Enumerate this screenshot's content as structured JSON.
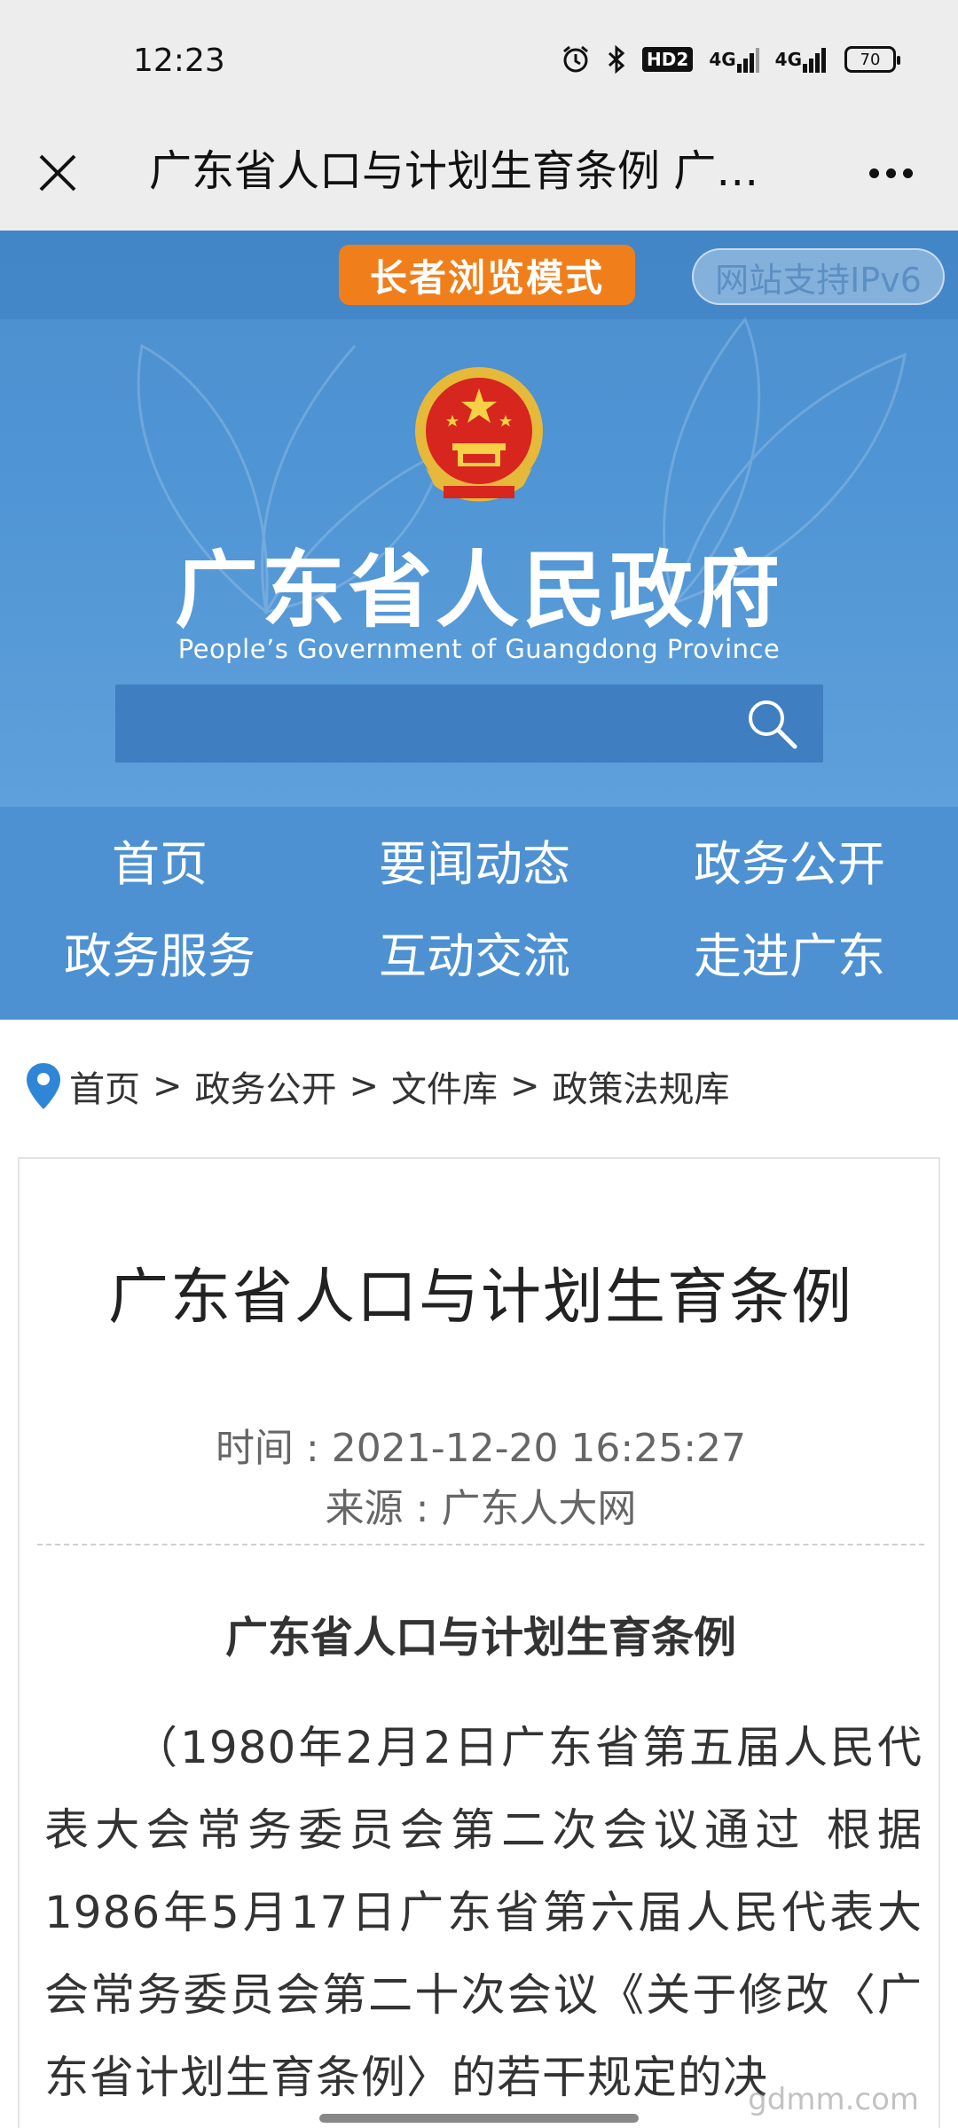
{
  "status_bar": {
    "time": "12:23",
    "icons": [
      "alarm-icon",
      "bluetooth-icon",
      "hd-icon",
      "signal-icon",
      "signal-icon",
      "battery-icon"
    ],
    "hd": "HD2",
    "sig1": "4G",
    "sig2": "4G",
    "battery": "70"
  },
  "title_bar": {
    "title": "广东省人口与计划生育条例  广…"
  },
  "header": {
    "elder_mode": "长者浏览模式",
    "ipv6": "网站支持IPv6",
    "gov_name": "广东省人民政府",
    "gov_name_en": "People’s Government of Guangdong Province",
    "search_placeholder": ""
  },
  "nav": {
    "items": [
      {
        "label": "首页"
      },
      {
        "label": "要闻动态"
      },
      {
        "label": "政务公开"
      },
      {
        "label": "政务服务"
      },
      {
        "label": "互动交流"
      },
      {
        "label": "走进广东"
      }
    ]
  },
  "breadcrumb": {
    "items": [
      "首页",
      "政务公开",
      "文件库",
      "政策法规库"
    ],
    "separator": ">"
  },
  "article": {
    "title": "广东省人口与计划生育条例",
    "time": "时间 : 2021-12-20 16:25:27",
    "source": "来源 : 广东人大网",
    "sub_title": "广东省人口与计划生育条例",
    "body": "（1980年2月2日广东省第五届人民代表大会常务委员会第二次会议通过 根据1986年5月17日广东省第六届人民代表大会常务委员会第二十次会议《关于修改〈广东省计划生育条例〉的若干规定的决"
  },
  "watermark": "gdmm.com",
  "colors": {
    "header_blue": "#4f94d4",
    "nav_blue": "#4e91d2",
    "elder_orange": "#f07f1b"
  }
}
